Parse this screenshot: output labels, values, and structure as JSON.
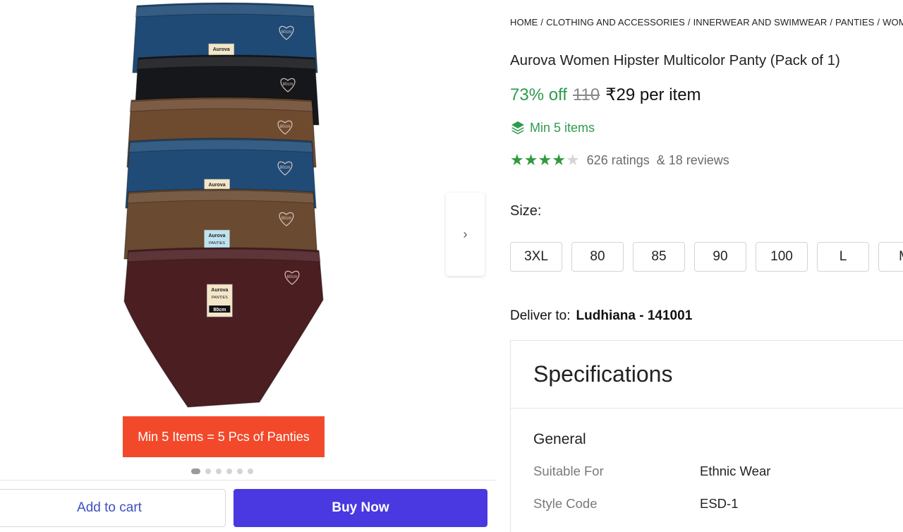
{
  "breadcrumb": [
    "HOME",
    "CLOTHING AND ACCESSORIES",
    "INNERWEAR AND SWIMWEAR",
    "PANTIES",
    "WOMEN"
  ],
  "breadcrumb_sep": "/",
  "product": {
    "title": "Aurova Women Hipster Multicolor Panty (Pack of 1)",
    "discount": "73% off",
    "mrp": "110",
    "price": "₹29 per item",
    "min_items": "Min 5 items",
    "rating_value": 4,
    "rating_max": 5,
    "ratings_text": "626 ratings",
    "reviews_text": "& 18 reviews"
  },
  "image": {
    "promo_text": "Min 5 Items = 5 Pcs of Panties",
    "label_brand": "Aurova",
    "label_type": "PANTIES",
    "label_size": "80cm",
    "waist_mark": "80cm",
    "dots_count": 6,
    "active_dot": 0,
    "garment_colors": [
      "#1f4a75",
      "#15171a",
      "#6e4a2f",
      "#204b77",
      "#6a4a30",
      "#4b1e22"
    ]
  },
  "sizes": {
    "label": "Size:",
    "options": [
      "3XL",
      "80",
      "85",
      "90",
      "100",
      "L",
      "M"
    ]
  },
  "delivery": {
    "label": "Deliver to:",
    "location": "Ludhiana - 141001"
  },
  "specifications": {
    "heading": "Specifications",
    "group": "General",
    "rows": [
      {
        "key": "Suitable For",
        "value": "Ethnic Wear"
      },
      {
        "key": "Style Code",
        "value": "ESD-1"
      }
    ]
  },
  "actions": {
    "add_to_cart": "Add to cart",
    "buy_now": "Buy Now",
    "next_icon": "chevron-right-icon"
  },
  "colors": {
    "accent": "#4a39e0",
    "discount_green": "#2e9b4e",
    "banner": "#f2492a"
  }
}
